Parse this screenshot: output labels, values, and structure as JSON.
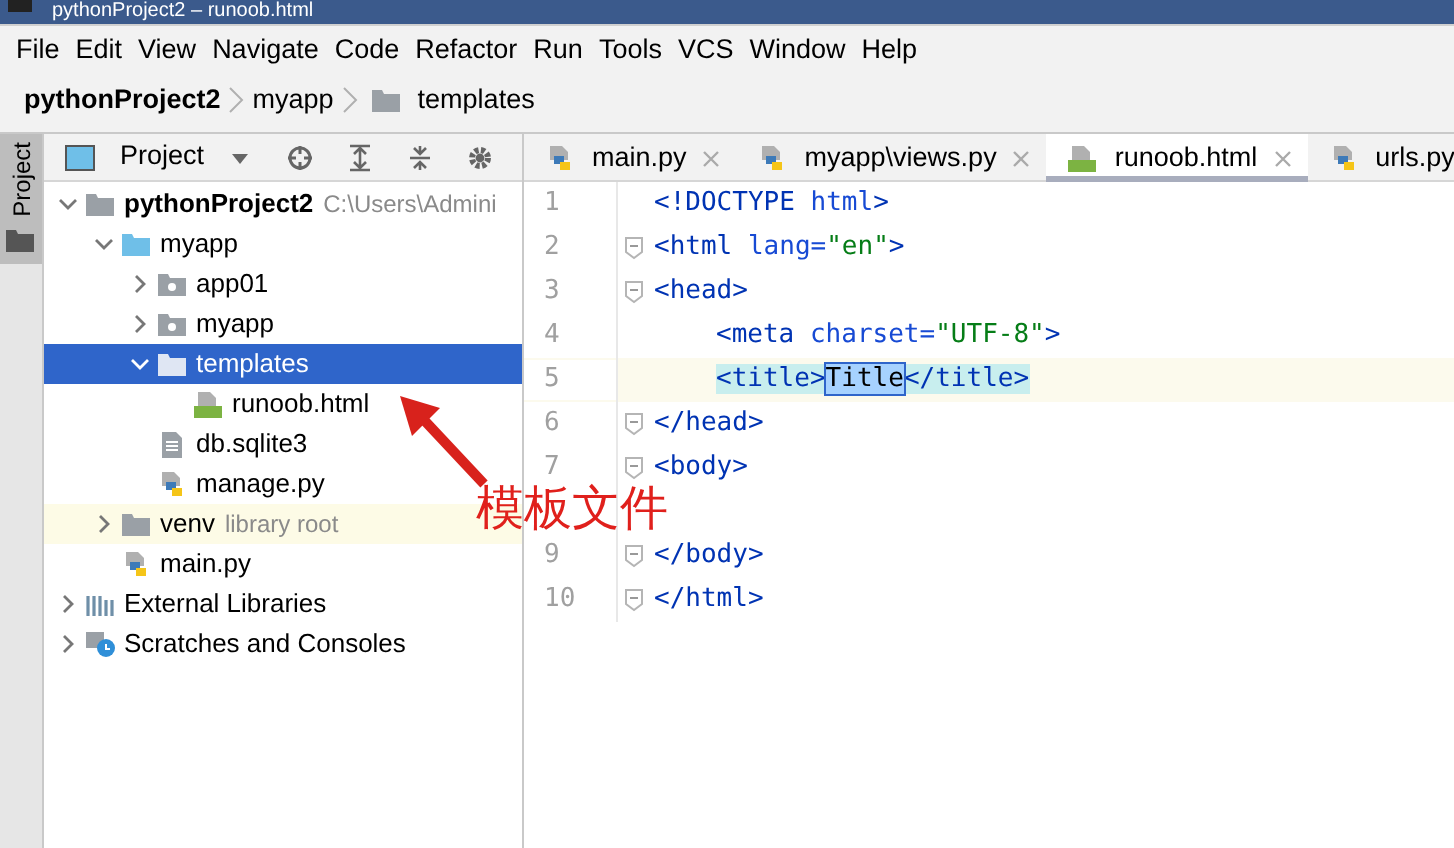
{
  "window": {
    "title": "pythonProject2 – runoob.html"
  },
  "menu": [
    {
      "label": "File"
    },
    {
      "label": "Edit"
    },
    {
      "label": "View"
    },
    {
      "label": "Navigate"
    },
    {
      "label": "Code"
    },
    {
      "label": "Refactor"
    },
    {
      "label": "Run"
    },
    {
      "label": "Tools"
    },
    {
      "label": "VCS"
    },
    {
      "label": "Window"
    },
    {
      "label": "Help"
    }
  ],
  "breadcrumb": [
    {
      "label": "pythonProject2",
      "kind": "project"
    },
    {
      "label": "myapp",
      "kind": "module"
    },
    {
      "label": "templates",
      "kind": "folder"
    }
  ],
  "tool_strip": {
    "label": "Project"
  },
  "project_panel": {
    "view": "Project",
    "tree": [
      {
        "label": "pythonProject2",
        "kind": "project",
        "note": "C:\\Users\\Admini",
        "expanded": true,
        "selected": false,
        "children": [
          {
            "label": "myapp",
            "kind": "module",
            "expanded": true,
            "selected": false,
            "children": [
              {
                "label": "app01",
                "kind": "package",
                "expanded": false,
                "selected": false
              },
              {
                "label": "myapp",
                "kind": "package",
                "expanded": false,
                "selected": false
              },
              {
                "label": "templates",
                "kind": "folder",
                "expanded": true,
                "selected": true,
                "children": [
                  {
                    "label": "runoob.html",
                    "kind": "html",
                    "selected": false
                  }
                ]
              },
              {
                "label": "db.sqlite3",
                "kind": "text",
                "selected": false
              },
              {
                "label": "manage.py",
                "kind": "python",
                "selected": false
              }
            ]
          },
          {
            "label": "venv",
            "kind": "venv",
            "note": "library root",
            "expanded": false,
            "selected": false
          },
          {
            "label": "main.py",
            "kind": "python",
            "selected": false
          }
        ]
      },
      {
        "label": "External Libraries",
        "kind": "libraries",
        "expanded": false,
        "selected": false
      },
      {
        "label": "Scratches and Consoles",
        "kind": "scratches",
        "expanded": false,
        "selected": false
      }
    ]
  },
  "editor": {
    "tabs": [
      {
        "label": "main.py",
        "kind": "python",
        "selected": false
      },
      {
        "label": "myapp\\views.py",
        "kind": "python",
        "selected": false
      },
      {
        "label": "runoob.html",
        "kind": "html",
        "selected": true
      },
      {
        "label": "urls.py",
        "kind": "python",
        "selected": false
      }
    ],
    "lines": [
      {
        "number": "1",
        "fold": false,
        "current": false,
        "indented": false,
        "tokens": [
          {
            "text": "<!DOCTYPE ",
            "kind": "tag"
          },
          {
            "text": "html",
            "kind": "attr"
          },
          {
            "text": ">",
            "kind": "tag"
          }
        ]
      },
      {
        "number": "2",
        "fold": true,
        "current": false,
        "indented": false,
        "tokens": [
          {
            "text": "<html ",
            "kind": "tag"
          },
          {
            "text": "lang=",
            "kind": "attr"
          },
          {
            "text": "\"en\"",
            "kind": "string"
          },
          {
            "text": ">",
            "kind": "tag"
          }
        ]
      },
      {
        "number": "3",
        "fold": true,
        "current": false,
        "indented": false,
        "tokens": [
          {
            "text": "<head>",
            "kind": "tag"
          }
        ]
      },
      {
        "number": "4",
        "fold": false,
        "current": false,
        "indented": true,
        "tokens": [
          {
            "text": "<meta ",
            "kind": "tag"
          },
          {
            "text": "charset=",
            "kind": "attr"
          },
          {
            "text": "\"UTF-8\"",
            "kind": "string"
          },
          {
            "text": ">",
            "kind": "tag"
          }
        ]
      },
      {
        "number": "5",
        "fold": false,
        "current": true,
        "indented": true,
        "tokens": [
          {
            "text": "<title>",
            "kind": "tag-match"
          },
          {
            "text": "Title",
            "kind": "selection"
          },
          {
            "text": "</title>",
            "kind": "tag-match"
          }
        ]
      },
      {
        "number": "6",
        "fold": true,
        "current": false,
        "indented": false,
        "tokens": [
          {
            "text": "</head>",
            "kind": "tag"
          }
        ]
      },
      {
        "number": "7",
        "fold": true,
        "current": false,
        "indented": false,
        "tokens": [
          {
            "text": "<body>",
            "kind": "tag"
          }
        ]
      },
      {
        "fold": false,
        "current": false
      },
      {
        "number": "9",
        "fold": true,
        "current": false,
        "indented": false,
        "tokens": [
          {
            "text": "</body>",
            "kind": "tag"
          }
        ]
      },
      {
        "number": "10",
        "fold": true,
        "current": false,
        "indented": false,
        "tokens": [
          {
            "text": "</html>",
            "kind": "tag"
          }
        ]
      }
    ]
  },
  "annotation": {
    "text": "模板文件"
  }
}
